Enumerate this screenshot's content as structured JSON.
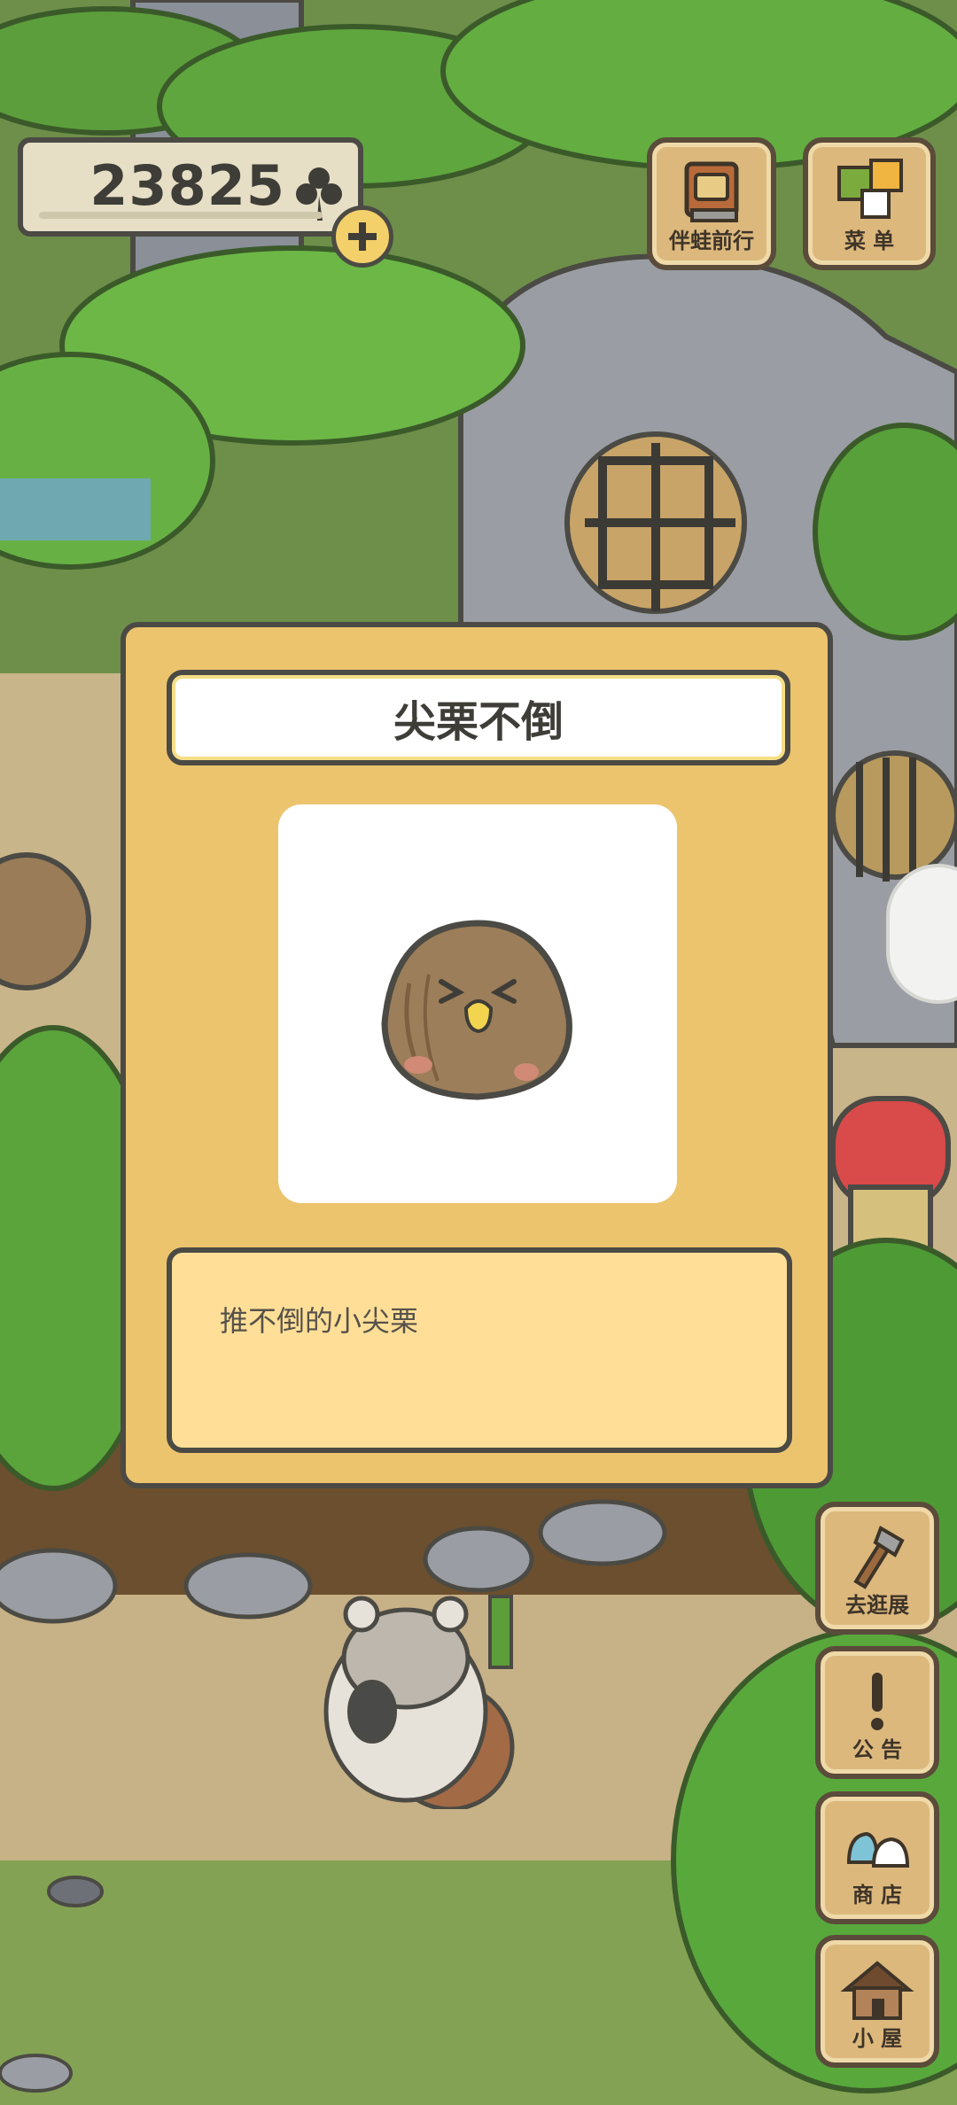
{
  "hud": {
    "clover_count": "23825",
    "travel_label": "伴蛙前行",
    "menu_label": "菜 单"
  },
  "side_menu": {
    "expo_label": "去逛展",
    "notice_label": "公 告",
    "shop_label": "商 店",
    "house_label": "小 屋"
  },
  "dialog": {
    "title": "尖栗不倒",
    "description": "推不倒的小尖栗"
  },
  "colors": {
    "dialog_bg": "#ecc46e",
    "desc_bg": "#ffdf97",
    "outline": "#4b4a44",
    "wood": "#dcb87d"
  },
  "icons": [
    "clover-icon",
    "plus-icon",
    "album-icon",
    "menu-icon",
    "shovel-icon",
    "exclamation-icon",
    "bag-icon",
    "house-icon",
    "chestnut-icon"
  ]
}
